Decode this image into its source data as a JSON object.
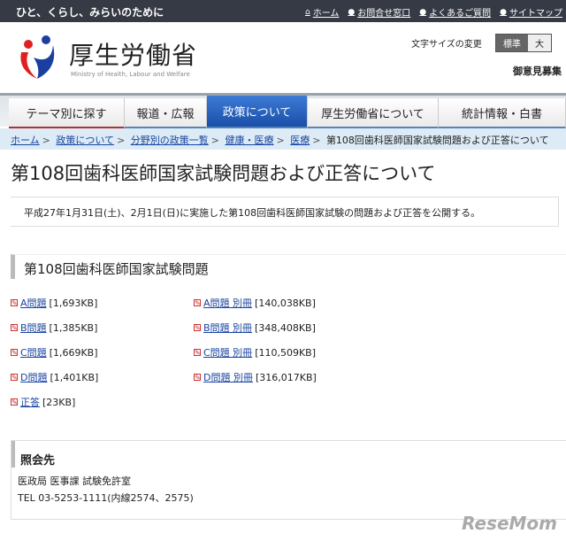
{
  "topbar": {
    "tagline": "ひと、くらし、みらいのために",
    "links": [
      "ホーム",
      "お問合せ窓口",
      "よくあるご質問",
      "サイトマップ"
    ]
  },
  "header": {
    "brand": "厚生労働省",
    "brand_en": "Ministry of Health, Labour and Welfare",
    "font_size_label": "文字サイズの変更",
    "font_sizes": [
      "標準",
      "大"
    ],
    "opinion": "御意見募集"
  },
  "nav": [
    "テーマ別に探す",
    "報道・広報",
    "政策について",
    "厚生労働省について",
    "統計情報・白書"
  ],
  "breadcrumb": {
    "links": [
      "ホーム",
      "政策について",
      "分野別の政策一覧",
      "健康・医療",
      "医療"
    ],
    "current": "第108回歯科医師国家試験問題および正答について"
  },
  "title": "第108回歯科医師国家試験問題および正答について",
  "summary": "平成27年1月31日(土)、2月1日(日)に実施した第108回歯科医師国家試験の問題および正答を公開する。",
  "section": "第108回歯科医師国家試験問題",
  "files_left": [
    {
      "label": "A問題",
      "size": "[1,693KB]"
    },
    {
      "label": "B問題",
      "size": "[1,385KB]"
    },
    {
      "label": "C問題",
      "size": "[1,669KB]"
    },
    {
      "label": "D問題",
      "size": "[1,401KB]"
    },
    {
      "label": "正答",
      "size": "[23KB]"
    }
  ],
  "files_right": [
    {
      "label": "A問題 別冊",
      "size": "[140,038KB]"
    },
    {
      "label": "B問題 別冊",
      "size": "[348,408KB]"
    },
    {
      "label": "C問題 別冊",
      "size": "[110,509KB]"
    },
    {
      "label": "D問題 別冊",
      "size": "[316,017KB]"
    }
  ],
  "contact": {
    "heading": "照会先",
    "dept": "医政局 医事課 試験免許室",
    "tel": "TEL  03-5253-1111(内線2574、2575)"
  },
  "watermark": "ReseMom"
}
